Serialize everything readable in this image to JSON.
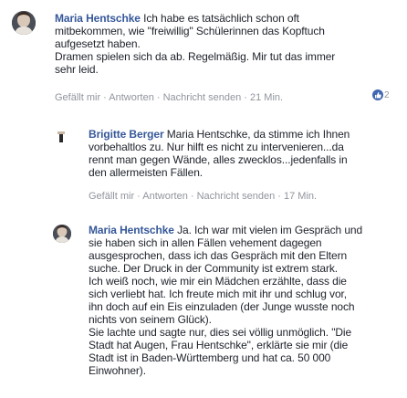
{
  "comments": [
    {
      "author": "Maria Hentschke",
      "lines": [
        "Ich habe es tatsächlich schon oft",
        "mitbekommen, wie \"freiwillig\" Schülerinnen das Kopftuch",
        "aufgesetzt haben.",
        "Dramen spielen sich da ab. Regelmäßig. Mir tut das immer",
        "sehr leid."
      ],
      "actions": {
        "like": "Gefällt mir",
        "reply": "Antworten",
        "message": "Nachricht senden",
        "time": "21 Min."
      },
      "reaction_count": "2"
    },
    {
      "author": "Brigitte Berger",
      "lines": [
        "Maria Hentschke, da stimme ich Ihnen",
        "vorbehaltlos zu. Nur hilft es nicht zu intervenieren...da",
        "rennt man gegen Wände, alles zwecklos...jedenfalls in",
        "den allermeisten Fällen."
      ],
      "actions": {
        "like": "Gefällt mir",
        "reply": "Antworten",
        "message": "Nachricht senden",
        "time": "17 Min."
      }
    },
    {
      "author": "Maria Hentschke",
      "lines": [
        "Ja. Ich war mit vielen im Gespräch und",
        "sie haben sich in allen Fällen vehement dagegen",
        "ausgesprochen, dass ich das Gespräch mit den Eltern",
        "suche. Der Druck in der Community ist extrem stark.",
        "Ich weiß noch, wie mir ein Mädchen erzählte, dass die",
        "sich verliebt hat. Ich freute mich mit ihr und schlug vor,",
        "ihn doch auf ein Eis einzuladen (der Junge wusste noch",
        "nichts von seinem Glück).",
        "Sie lachte und sagte nur, dies sei völlig unmöglich. \"Die",
        "Stadt hat Augen, Frau Hentschke\", erklärte sie mir (die",
        "Stadt ist in Baden-Württemberg und hat ca. 50 000",
        "Einwohner)."
      ]
    }
  ],
  "separator": " · ",
  "colors": {
    "name": "#365899",
    "actions": "#90949c",
    "like_badge": "#4267b2"
  }
}
